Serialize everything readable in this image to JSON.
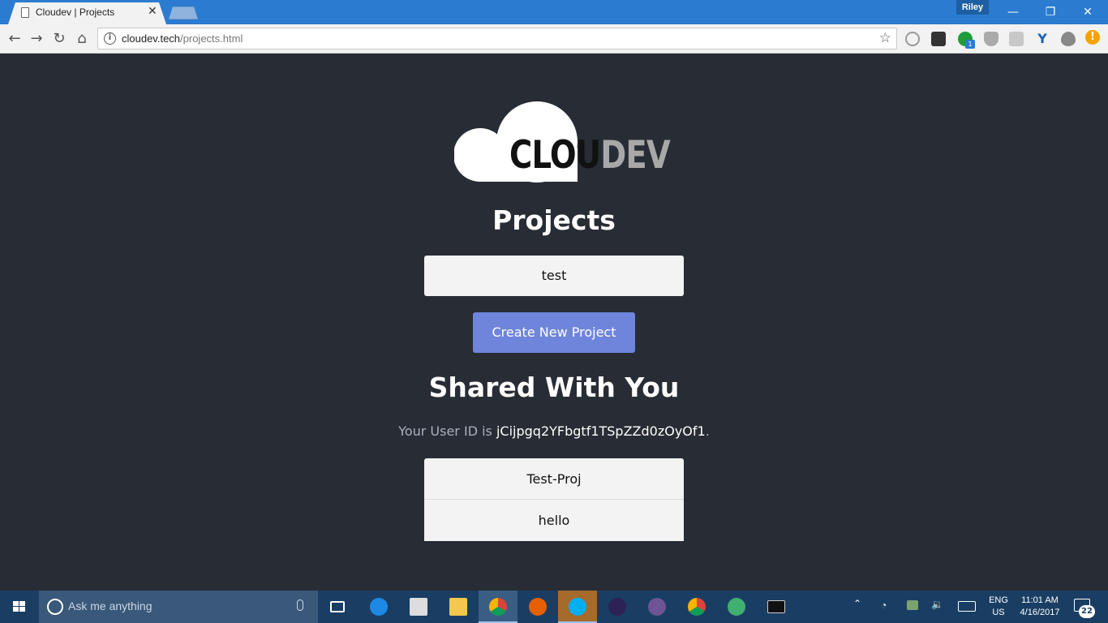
{
  "browser": {
    "tab_title": "Cloudev | Projects",
    "tab_close": "✕",
    "profile_name": "Riley",
    "url_host": "cloudev.tech",
    "url_path": "/projects.html",
    "extension_badge_count": "1",
    "window_controls": {
      "minimize": "—",
      "restore": "❐",
      "close": "✕"
    }
  },
  "logo": {
    "text_dark": "CLOU",
    "text_light": "DEV"
  },
  "page": {
    "title": "Projects",
    "projects": [
      {
        "name": "test"
      }
    ],
    "create_button_label": "Create New Project",
    "shared_title": "Shared With You",
    "user_id_prefix": "Your User ID is ",
    "user_id": "jCijpgq2YFbgtf1TSpZZd0zOyOf1",
    "user_id_suffix": ".",
    "shared_projects": [
      {
        "name": "Test-Proj"
      },
      {
        "name": "hello"
      }
    ]
  },
  "taskbar": {
    "search_placeholder": "Ask me anything",
    "language_top": "ENG",
    "language_bottom": "US",
    "time": "11:01 AM",
    "date": "4/16/2017",
    "notification_count": "22"
  },
  "colors": {
    "page_background": "#282c34",
    "accent_button": "#6f85dc",
    "chrome_frame": "#2b7bd0",
    "taskbar": "#1a3e63"
  }
}
